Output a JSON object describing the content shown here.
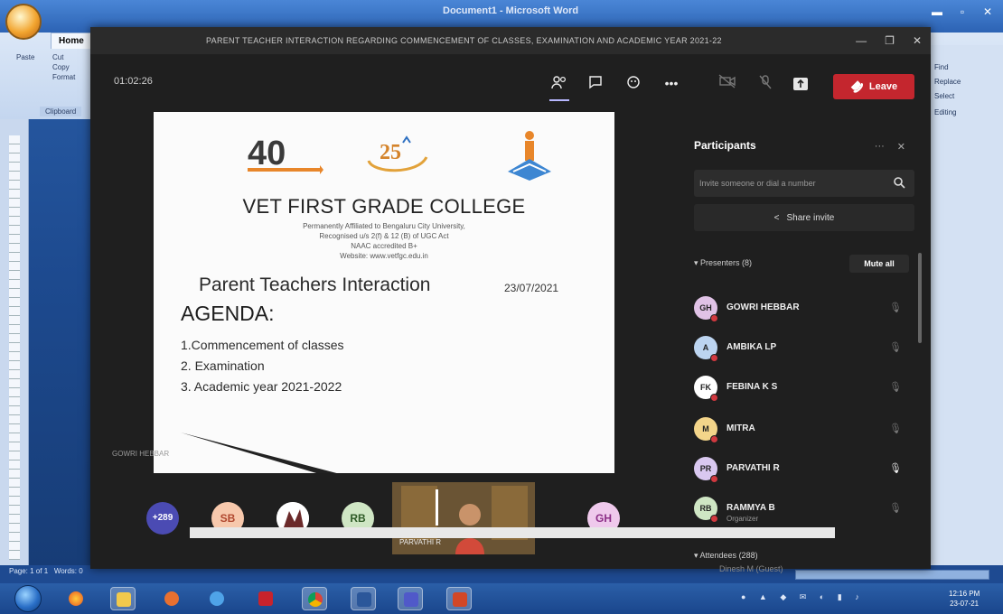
{
  "word": {
    "title": "Document1 - Microsoft Word",
    "home_tab": "Home",
    "paste_label": "Paste",
    "clipboard_items": [
      "Cut",
      "Copy",
      "Format"
    ],
    "clipboard_label": "Clipboard",
    "right_items": [
      "Find",
      "Replace",
      "Select"
    ],
    "editing_label": "Editing",
    "status_page": "Page: 1 of 1",
    "status_words": "Words: 0"
  },
  "meeting": {
    "title": "PARENT TEACHER INTERACTION REGARDING COMMENCEMENT OF CLASSES, EXAMINATION AND ACADEMIC YEAR 2021-22",
    "timer": "01:02:26",
    "leave_label": "Leave"
  },
  "slide": {
    "logo_40": "40",
    "logo_25": "25",
    "college": "VET FIRST GRADE COLLEGE",
    "sub_lines": [
      "Permanently Affiliated to Bengaluru City University,",
      "Recognised u/s 2(f) & 12 (B) of UGC Act",
      "NAAC accredited B+",
      "Website: www.vetfgc.edu.in"
    ],
    "heading": "Parent Teachers Interaction",
    "date": "23/07/2021",
    "agenda_title": "AGENDA:",
    "agenda_items": [
      "1.Commencement of classes",
      "2. Examination",
      "3. Academic year 2021-2022"
    ],
    "presenter": "GOWRI HEBBAR"
  },
  "participants": {
    "title": "Participants",
    "invite_placeholder": "Invite someone or dial a number",
    "share_invite": "Share invite",
    "presenters_header": "Presenters (8)",
    "mute_all": "Mute all",
    "attendees_header": "Attendees (288)",
    "list": [
      {
        "initials": "GH",
        "name": "GOWRI HEBBAR",
        "role": "",
        "color": "#e0c2e6",
        "mic_on": false
      },
      {
        "initials": "A",
        "name": "AMBIKA LP",
        "role": "",
        "color": "#bcd4f0",
        "mic_on": false
      },
      {
        "initials": "FK",
        "name": "FEBINA K S",
        "role": "",
        "color": "#ffffff",
        "mic_on": false
      },
      {
        "initials": "M",
        "name": "MITRA",
        "role": "",
        "color": "#f3d58a",
        "mic_on": false
      },
      {
        "initials": "PR",
        "name": "PARVATHI R",
        "role": "",
        "color": "#d9c8f0",
        "mic_on": true
      },
      {
        "initials": "RB",
        "name": "RAMMYA B",
        "role": "Organizer",
        "color": "#cfe6c4",
        "mic_on": false
      }
    ],
    "next_attendee": "Dinesh M (Guest)"
  },
  "videostrip": {
    "overflow_count": "+289",
    "tiles": [
      {
        "initials": "SB",
        "color": "#f7c8ac"
      },
      {
        "initials": "RB",
        "color": "#cfe6c4"
      },
      {
        "initials": "GH",
        "color": "#efc9ec"
      }
    ],
    "video_name": "PARVATHI R"
  },
  "taskbar": {
    "clock_time": "12:16 PM",
    "clock_date": "23-07-21"
  }
}
